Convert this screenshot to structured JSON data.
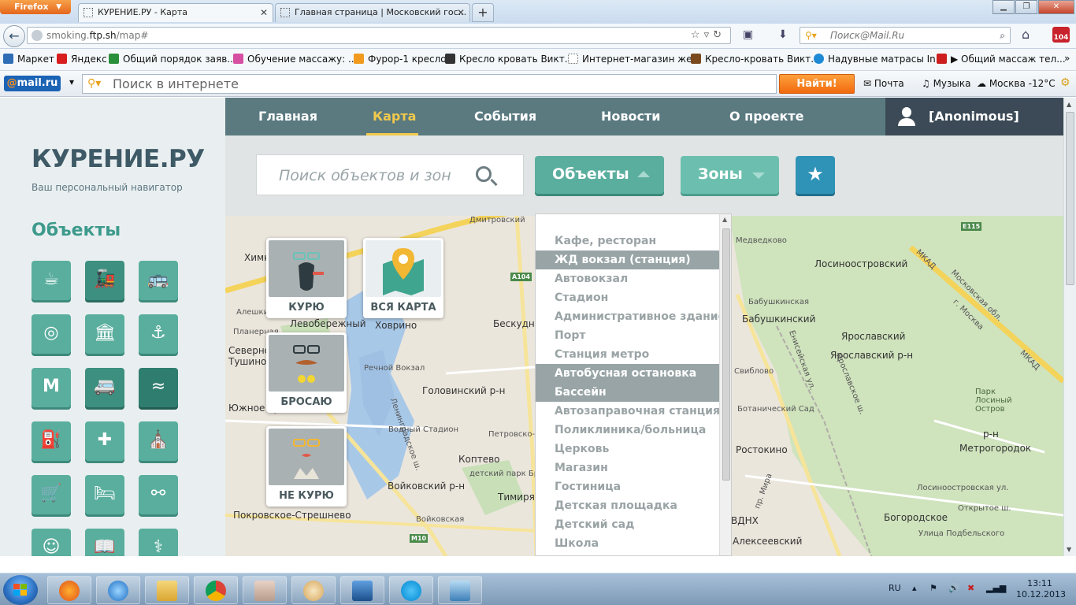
{
  "browser": {
    "firefox_button": "Firefox",
    "tabs": [
      {
        "title": "КУРЕНИЕ.РУ - Карта"
      },
      {
        "title": "Главная страница | Московский гос..."
      }
    ],
    "url_host_pre": "smoking.",
    "url_host_main": "ftp.sh",
    "url_path": "/map#",
    "search_placeholder": "Поиск@Mail.Ru",
    "mail_badge": "104",
    "bookmarks": [
      {
        "label": "Маркет",
        "color": "#2f6db5"
      },
      {
        "label": "Яндекс",
        "color": "#d81e1e"
      },
      {
        "label": "Общий порядок заяв...",
        "color": "#2a8f3a"
      },
      {
        "label": "Обучение массажу: ...",
        "color": "#d64fa3"
      },
      {
        "label": "Фурор-1 кресло",
        "color": "#f29a1e"
      },
      {
        "label": "Кресло кровать Викт...",
        "color": "#333333"
      },
      {
        "label": "Интернет-магазин же...",
        "color": "#ffffff"
      },
      {
        "label": "Кресло-кровать Викт...",
        "color": "#7a4a1e"
      },
      {
        "label": "Надувные матрасы In...",
        "color": "#1e8ad6"
      },
      {
        "label": "▶ Общий массаж тел...",
        "color": "#cc1e1e"
      }
    ]
  },
  "mailru": {
    "logo": "mail.ru",
    "search_placeholder": "Поиск в интернете",
    "find_button": "Найти!",
    "mail_label": "Почта",
    "music_label": "Музыка",
    "weather_label": "Москва -12°C"
  },
  "site": {
    "logo": "КУРЕНИЕ.РУ",
    "tagline": "Ваш персональный навигатор",
    "sidebar_title": "Объекты",
    "sidebar_icons": [
      "cafe-icon",
      "train-icon",
      "bus-station-icon",
      "stadium-icon",
      "admin-building-icon",
      "port-anchor-icon",
      "metro-icon",
      "bus-stop-icon",
      "pool-icon",
      "gas-station-icon",
      "hospital-icon",
      "church-icon",
      "shop-cart-icon",
      "hotel-bed-icon",
      "playground-swing-icon",
      "kindergarten-icon",
      "school-book-icon",
      "pharmacy-icon"
    ],
    "nav": [
      {
        "label": "Главная",
        "active": false
      },
      {
        "label": "Карта",
        "active": true
      },
      {
        "label": "События",
        "active": false
      },
      {
        "label": "Новости",
        "active": false
      },
      {
        "label": "О проекте",
        "active": false
      }
    ],
    "user": "[Anonimous]",
    "search_placeholder": "Поиск объектов и зон",
    "objects_button": "Объекты",
    "zones_button": "Зоны",
    "favorites_icon": "★",
    "cards": [
      {
        "label": "КУРЮ"
      },
      {
        "label": "ВСЯ КАРТА"
      },
      {
        "label": "БРОСАЮ"
      },
      {
        "label": "НЕ КУРЮ"
      }
    ],
    "dropdown_items": [
      {
        "label": "Кафе, ресторан",
        "selected": false
      },
      {
        "label": "ЖД вокзал (станция)",
        "selected": true
      },
      {
        "label": "Автовокзал",
        "selected": false
      },
      {
        "label": "Стадион",
        "selected": false
      },
      {
        "label": "Административное здание",
        "selected": false
      },
      {
        "label": "Порт",
        "selected": false
      },
      {
        "label": "Станция метро",
        "selected": false
      },
      {
        "label": "Автобусная остановка",
        "selected": true
      },
      {
        "label": "Бассейн",
        "selected": true
      },
      {
        "label": "Автозаправочная станция",
        "selected": false
      },
      {
        "label": "Поликлиника/больница",
        "selected": false
      },
      {
        "label": "Церковь",
        "selected": false
      },
      {
        "label": "Магазин",
        "selected": false
      },
      {
        "label": "Гостиница",
        "selected": false
      },
      {
        "label": "Детская площадка",
        "selected": false
      },
      {
        "label": "Детский сад",
        "selected": false
      },
      {
        "label": "Школа",
        "selected": false
      }
    ],
    "map_labels": [
      "Химки",
      "Левобережный",
      "Ховрино",
      "Алешкинский лес",
      "Планерная",
      "Северное Тушино",
      "Тушино",
      "Южное Тушино",
      "Речной Вокзал",
      "Головинский р-н",
      "Водный Стадион",
      "Петровско-Разумовская",
      "Коптево",
      "детский парк Бригантина",
      "Войковский р-н",
      "Тимирязевский",
      "Войковская",
      "Покровское-Стрешнево",
      "Бескудниковский",
      "Дмитровский",
      "Медведково",
      "Лосиноостровский",
      "Бабушкинская",
      "Бабушкинский",
      "Ярославский",
      "Ярославский р-н",
      "Свиблово",
      "Ботанический Сад",
      "Ростокино",
      "Парк Лосиный Остров",
      "Метрогородок",
      "Богородское",
      "Улица Подбельского",
      "ВДНХ",
      "Алексеевский",
      "Лосиноостровская ул.",
      "Открытое ш.",
      "Ленинградское ш.",
      "Енисейская ул.",
      "Ярославское ш.",
      "пр. Мира",
      "Московская обл.",
      "г. Москва",
      "МКАД",
      "р-н",
      "МКАД"
    ],
    "map_shields": [
      "A104",
      "M10",
      "E115"
    ]
  },
  "taskbar": {
    "lang": "RU",
    "time": "13:11",
    "date": "10.12.2013"
  }
}
